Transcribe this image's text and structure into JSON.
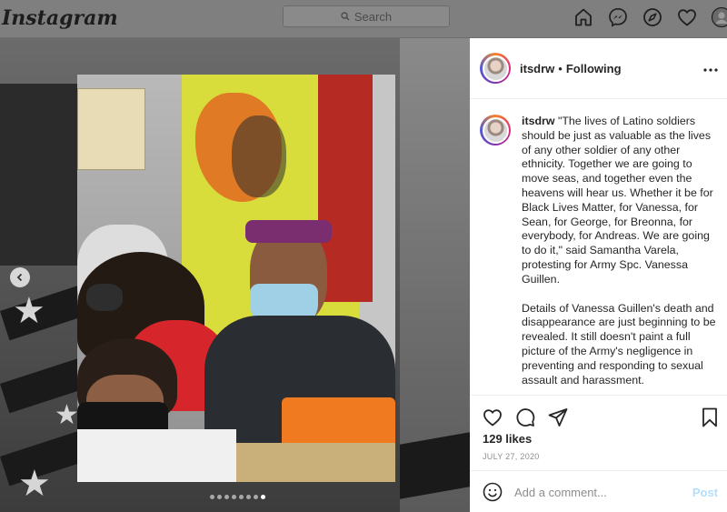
{
  "nav": {
    "logo": "Instagram",
    "search_placeholder": "Search",
    "icons": [
      "home-icon",
      "messenger-icon",
      "explore-icon",
      "activity-heart-icon",
      "profile-avatar-icon"
    ]
  },
  "post": {
    "username": "itsdrw",
    "follow_status": "Following",
    "separator": "•",
    "caption_p1": "\"The lives of Latino soldiers should be just as valuable as the lives of any other soldier of any other ethnicity. Together we are going to move seas, and together even the heavens will hear us. Whether it be for Black Lives Matter, for Vanessa, for Sean, for George, for Breonna, for everybody, for Andreas. We are going to do it,\" said Samantha Varela, protesting for Army Spc. Vanessa Guillen.",
    "caption_p2": "Details of Vanessa Guillen's death and disappearance are just beginning to be revealed. It still doesn't paint a full picture of the Army's negligence in preventing and responding to sexual assault and harassment.",
    "likes": "129 likes",
    "date": "JULY 27, 2020",
    "carousel_total": 8,
    "carousel_active": 8
  },
  "comment": {
    "placeholder": "Add a comment...",
    "post_label": "Post"
  },
  "colors": {
    "post_button_disabled": "#b2dffc",
    "secondary_text": "#8e8e8e",
    "overlay_gray": "#7f7f7f"
  }
}
